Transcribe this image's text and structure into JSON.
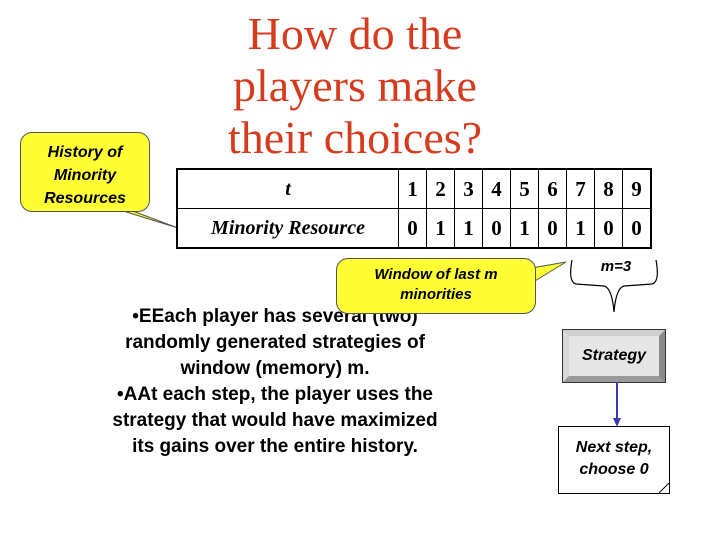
{
  "title": {
    "lines": [
      "How do the",
      "players make",
      "their choices?"
    ],
    "color": "#d63b1e"
  },
  "callouts": {
    "history": {
      "lines": [
        "History of",
        "Minority",
        "Resources"
      ]
    },
    "window": {
      "lines": [
        "Window of last m",
        "minorities"
      ]
    },
    "fill_color": "#ffff33"
  },
  "history_table": {
    "row_labels": [
      "t",
      "Minority Resource"
    ],
    "t": [
      "1",
      "2",
      "3",
      "4",
      "5",
      "6",
      "7",
      "8",
      "9"
    ],
    "minority": [
      "0",
      "1",
      "1",
      "0",
      "1",
      "0",
      "1",
      "0",
      "0"
    ]
  },
  "body": {
    "bullets": [
      [
        "•EEach player has several (two)",
        "randomly generated strategies of",
        "window (memory) m."
      ],
      [
        "•AAt each step, the player uses the",
        "strategy that would have maximized",
        "its gains over the entire history."
      ]
    ]
  },
  "diagram": {
    "m_label": "m=3",
    "strategy_label": "Strategy",
    "next_lines": [
      "Next step,",
      "choose 0"
    ],
    "arrow_color": "#3b3bb0"
  }
}
